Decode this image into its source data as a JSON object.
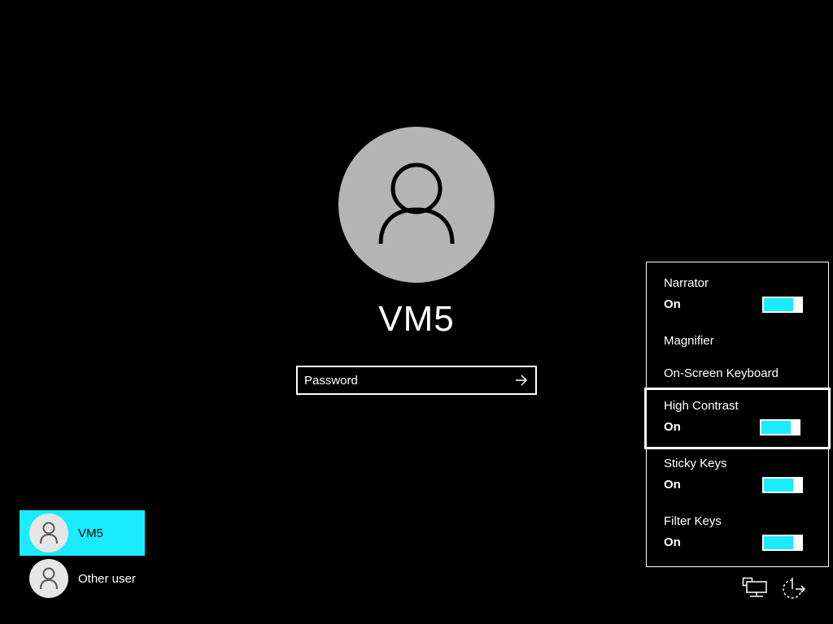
{
  "account": {
    "name": "VM5"
  },
  "password": {
    "placeholder": "Password"
  },
  "users": [
    {
      "name": "VM5",
      "selected": true
    },
    {
      "name": "Other user",
      "selected": false
    }
  ],
  "ease_of_access": {
    "items": [
      {
        "label": "Narrator",
        "status": "On",
        "toggle_on": true
      },
      {
        "label": "Magnifier"
      },
      {
        "label": "On-Screen Keyboard"
      },
      {
        "label": "High Contrast",
        "status": "On",
        "toggle_on": true,
        "focused": true
      },
      {
        "label": "Sticky Keys",
        "status": "On",
        "toggle_on": true
      },
      {
        "label": "Filter Keys",
        "status": "On",
        "toggle_on": true
      }
    ]
  },
  "tray": {
    "icons": [
      "network-icon",
      "power-icon"
    ]
  },
  "colors": {
    "accent": "#1aebff",
    "background": "#000000",
    "avatar_bg": "#b4b4b4"
  }
}
